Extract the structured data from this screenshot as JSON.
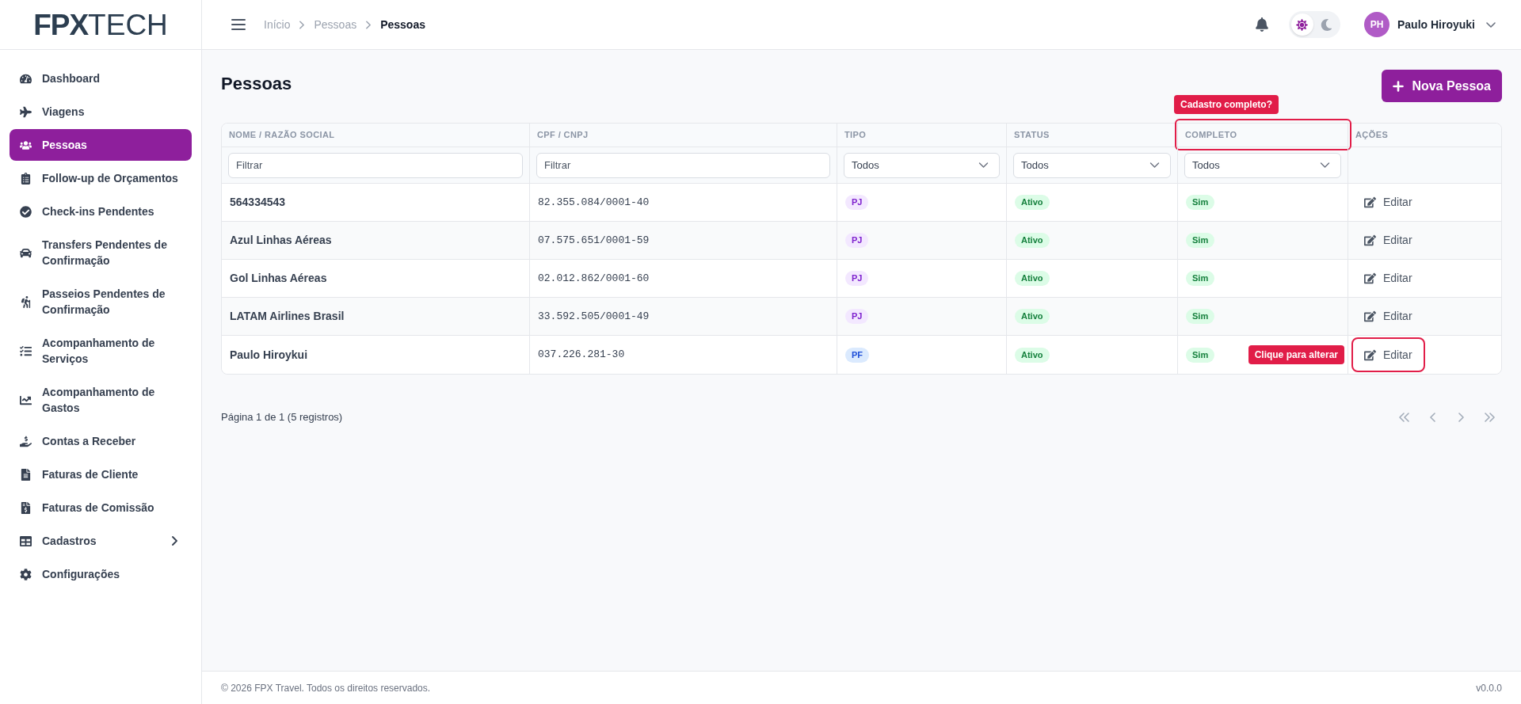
{
  "sidebar": {
    "logo": {
      "bold": "FPX",
      "light": "TECH"
    },
    "items": [
      {
        "label": "Dashboard",
        "kind": "link",
        "selected": false
      },
      {
        "label": "Viagens",
        "kind": "link",
        "selected": false
      },
      {
        "label": "Pessoas",
        "kind": "link",
        "selected": true
      },
      {
        "label": "Follow-up de Orçamentos",
        "kind": "link",
        "selected": false
      },
      {
        "label": "Check-ins Pendentes",
        "kind": "link",
        "selected": false
      },
      {
        "label": "Transfers Pendentes de Confirmação",
        "kind": "link",
        "selected": false
      },
      {
        "label": "Passeios Pendentes de Confirmação",
        "kind": "link",
        "selected": false
      },
      {
        "label": "Acompanhamento de Serviços",
        "kind": "link",
        "selected": false
      },
      {
        "label": "Acompanhamento de Gastos",
        "kind": "link",
        "selected": false
      },
      {
        "label": "Contas a Receber",
        "kind": "link",
        "selected": false
      },
      {
        "label": "Faturas de Cliente",
        "kind": "link",
        "selected": false
      },
      {
        "label": "Faturas de Comissão",
        "kind": "link",
        "selected": false
      },
      {
        "label": "Cadastros",
        "kind": "group",
        "selected": false,
        "expanded": false
      },
      {
        "label": "Configurações",
        "kind": "link",
        "selected": false
      }
    ]
  },
  "header": {
    "breadcrumb": [
      {
        "label": "Início",
        "current": false
      },
      {
        "label": "Pessoas",
        "current": false
      },
      {
        "label": "Pessoas",
        "current": true
      }
    ],
    "theme_toggle": [
      {
        "kind": "light",
        "selected": true
      },
      {
        "kind": "dark",
        "selected": false
      }
    ],
    "user": {
      "initials": "PH",
      "name": "Paulo Hiroyuki"
    }
  },
  "page": {
    "title": "Pessoas",
    "primary_button": "Nova Pessoa"
  },
  "table": {
    "columns": [
      {
        "label": "NOME / RAZÃO SOCIAL",
        "filter": {
          "kind": "text",
          "placeholder": "Filtrar"
        }
      },
      {
        "label": "CPF / CNPJ",
        "filter": {
          "kind": "text",
          "placeholder": "Filtrar"
        }
      },
      {
        "label": "TIPO",
        "filter": {
          "kind": "select",
          "value": "Todos"
        }
      },
      {
        "label": "STATUS",
        "filter": {
          "kind": "select",
          "value": "Todos"
        }
      },
      {
        "label": "COMPLETO",
        "annotation": {
          "callout": "Cadastro completo?"
        },
        "filter": {
          "kind": "select",
          "value": "Todos"
        }
      },
      {
        "label": "AÇÕES"
      }
    ],
    "rows": [
      {
        "name": "564334543",
        "document": "82.355.084/0001-40",
        "type": {
          "label": "PJ",
          "kind": "company"
        },
        "status": {
          "label": "Ativo",
          "kind": "active"
        },
        "complete": {
          "label": "Sim",
          "kind": "yes"
        },
        "action": {
          "label": "Editar",
          "highlighted": false
        }
      },
      {
        "name": "Azul Linhas Aéreas",
        "document": "07.575.651/0001-59",
        "type": {
          "label": "PJ",
          "kind": "company"
        },
        "status": {
          "label": "Ativo",
          "kind": "active"
        },
        "complete": {
          "label": "Sim",
          "kind": "yes"
        },
        "action": {
          "label": "Editar",
          "highlighted": false
        }
      },
      {
        "name": "Gol Linhas Aéreas",
        "document": "02.012.862/0001-60",
        "type": {
          "label": "PJ",
          "kind": "company"
        },
        "status": {
          "label": "Ativo",
          "kind": "active"
        },
        "complete": {
          "label": "Sim",
          "kind": "yes"
        },
        "action": {
          "label": "Editar",
          "highlighted": false
        }
      },
      {
        "name": "LATAM Airlines Brasil",
        "document": "33.592.505/0001-49",
        "type": {
          "label": "PJ",
          "kind": "company"
        },
        "status": {
          "label": "Ativo",
          "kind": "active"
        },
        "complete": {
          "label": "Sim",
          "kind": "yes"
        },
        "action": {
          "label": "Editar",
          "highlighted": false
        }
      },
      {
        "name": "Paulo Hiroykui",
        "document": "037.226.281-30",
        "type": {
          "label": "PF",
          "kind": "person"
        },
        "status": {
          "label": "Ativo",
          "kind": "active"
        },
        "complete": {
          "label": "Sim",
          "kind": "yes"
        },
        "action": {
          "label": "Editar",
          "highlighted": true,
          "callout": "Clique para alterar"
        }
      }
    ]
  },
  "pagination": {
    "summary": "Página 1 de 1 (5 registros)",
    "controls": [
      {
        "kind": "first",
        "disabled": true
      },
      {
        "kind": "previous",
        "disabled": true
      },
      {
        "kind": "next",
        "disabled": true
      },
      {
        "kind": "last",
        "disabled": true
      }
    ]
  },
  "footer": {
    "copyright": "© 2026 FPX Travel. Todos os direitos reservados.",
    "version": "v0.0.0"
  }
}
